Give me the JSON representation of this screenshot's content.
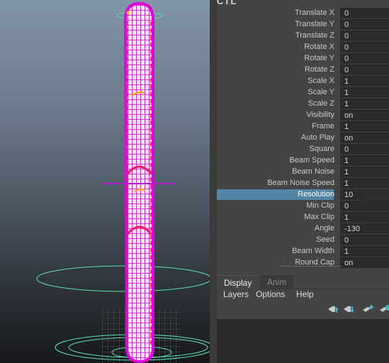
{
  "viewport": {
    "label": "3D viewport",
    "object": "Beam mesh (wireframe, selected)",
    "colors": {
      "selection_wire": "#e000d8",
      "highlight_wire": "#ff1464",
      "manipulator_rings": "#5ce0b0",
      "grid": "#5a5a5a"
    }
  },
  "attribute_editor": {
    "node_title": "CTL",
    "attributes": [
      {
        "label": "Translate X",
        "value": "0"
      },
      {
        "label": "Translate Y",
        "value": "0"
      },
      {
        "label": "Translate Z",
        "value": "0"
      },
      {
        "label": "Rotate X",
        "value": "0"
      },
      {
        "label": "Rotate Y",
        "value": "0"
      },
      {
        "label": "Rotate Z",
        "value": "0"
      },
      {
        "label": "Scale X",
        "value": "1"
      },
      {
        "label": "Scale Y",
        "value": "1"
      },
      {
        "label": "Scale Z",
        "value": "1"
      },
      {
        "label": "Visibility",
        "value": "on"
      },
      {
        "label": "Frame",
        "value": "1"
      },
      {
        "label": "Auto Play",
        "value": "on"
      },
      {
        "label": "Square",
        "value": "0"
      },
      {
        "label": "Beam Speed",
        "value": "1"
      },
      {
        "label": "Beam Noise",
        "value": "1"
      },
      {
        "label": "Beam Noise Speed",
        "value": "1"
      },
      {
        "label": "Resolution",
        "value": "10",
        "selected": true
      },
      {
        "label": "Min Clip",
        "value": "0"
      },
      {
        "label": "Max Clip",
        "value": "1"
      },
      {
        "label": "Angle",
        "value": "-130"
      },
      {
        "label": "Seed",
        "value": "0"
      },
      {
        "label": "Beam Width",
        "value": "1"
      },
      {
        "label": "Round Cap",
        "value": "on"
      }
    ],
    "selected_color": "#5285a6"
  },
  "layer_editor": {
    "tabs": [
      {
        "label": "Display",
        "active": true
      },
      {
        "label": "Anim",
        "active": false
      }
    ],
    "menu": [
      "Layers",
      "Options",
      "Help"
    ],
    "toolbar": [
      {
        "icon": "move-layer-up-icon"
      },
      {
        "icon": "move-layer-down-icon"
      },
      {
        "icon": "new-empty-layer-icon"
      },
      {
        "icon": "new-layer-from-selected-icon"
      }
    ],
    "accent": "#3fb8c8"
  }
}
